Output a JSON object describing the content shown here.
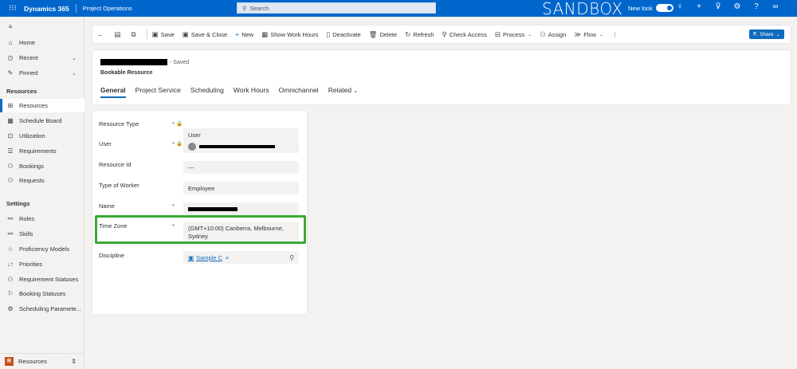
{
  "topbar": {
    "app_name": "Dynamics 365",
    "area_name": "Project Operations",
    "search_placeholder": "Search",
    "env_label": "SANDBOX",
    "new_look_label": "New look"
  },
  "sidebar": {
    "top_items": [
      {
        "label": "Home",
        "icon": "home-icon"
      },
      {
        "label": "Recent",
        "icon": "clock-icon"
      },
      {
        "label": "Pinned",
        "icon": "pin-icon"
      }
    ],
    "section1": "Resources",
    "section1_items": [
      {
        "label": "Resources",
        "icon": "resources-icon"
      },
      {
        "label": "Schedule Board",
        "icon": "calendar-icon"
      },
      {
        "label": "Utilization",
        "icon": "chart-icon"
      },
      {
        "label": "Requirements",
        "icon": "list-icon"
      },
      {
        "label": "Bookings",
        "icon": "people-icon"
      },
      {
        "label": "Requests",
        "icon": "requests-icon"
      }
    ],
    "section2": "Settings",
    "section2_items": [
      {
        "label": "Roles",
        "icon": "roles-icon"
      },
      {
        "label": "Skills",
        "icon": "skills-icon"
      },
      {
        "label": "Proficiency Models",
        "icon": "star-icon"
      },
      {
        "label": "Priorities",
        "icon": "sort-icon"
      },
      {
        "label": "Requirement Statuses",
        "icon": "status-icon"
      },
      {
        "label": "Booking Statuses",
        "icon": "flag-icon"
      },
      {
        "label": "Scheduling Paramete...",
        "icon": "gear-icon"
      }
    ],
    "area_switcher": {
      "badge": "R",
      "label": "Resources"
    }
  },
  "commands": {
    "save": "Save",
    "save_close": "Save & Close",
    "new": "New",
    "show_work_hours": "Show Work Hours",
    "deactivate": "Deactivate",
    "delete": "Delete",
    "refresh": "Refresh",
    "check_access": "Check Access",
    "process": "Process",
    "assign": "Assign",
    "flow": "Flow",
    "share": "Share"
  },
  "record": {
    "saved_label": "- Saved",
    "entity_label": "Bookable Resource"
  },
  "tabs": [
    "General",
    "Project Service",
    "Scheduling",
    "Work Hours",
    "Omnichannel",
    "Related"
  ],
  "form": {
    "resource_type_label": "Resource Type",
    "resource_type_value": "User",
    "user_label": "User",
    "resource_id_label": "Resource Id",
    "resource_id_value": "---",
    "worker_type_label": "Type of Worker",
    "worker_type_value": "Employee",
    "name_label": "Name",
    "time_zone_label": "Time Zone",
    "time_zone_value": "(GMT+10:00) Canberra, Melbourne, Sydney",
    "discipline_label": "Discipline",
    "discipline_value": "Sample C",
    "required_mark": "*"
  },
  "colors": {
    "brand": "#0066cc",
    "accent": "#0f6cbd",
    "highlight": "#3aaa35"
  }
}
